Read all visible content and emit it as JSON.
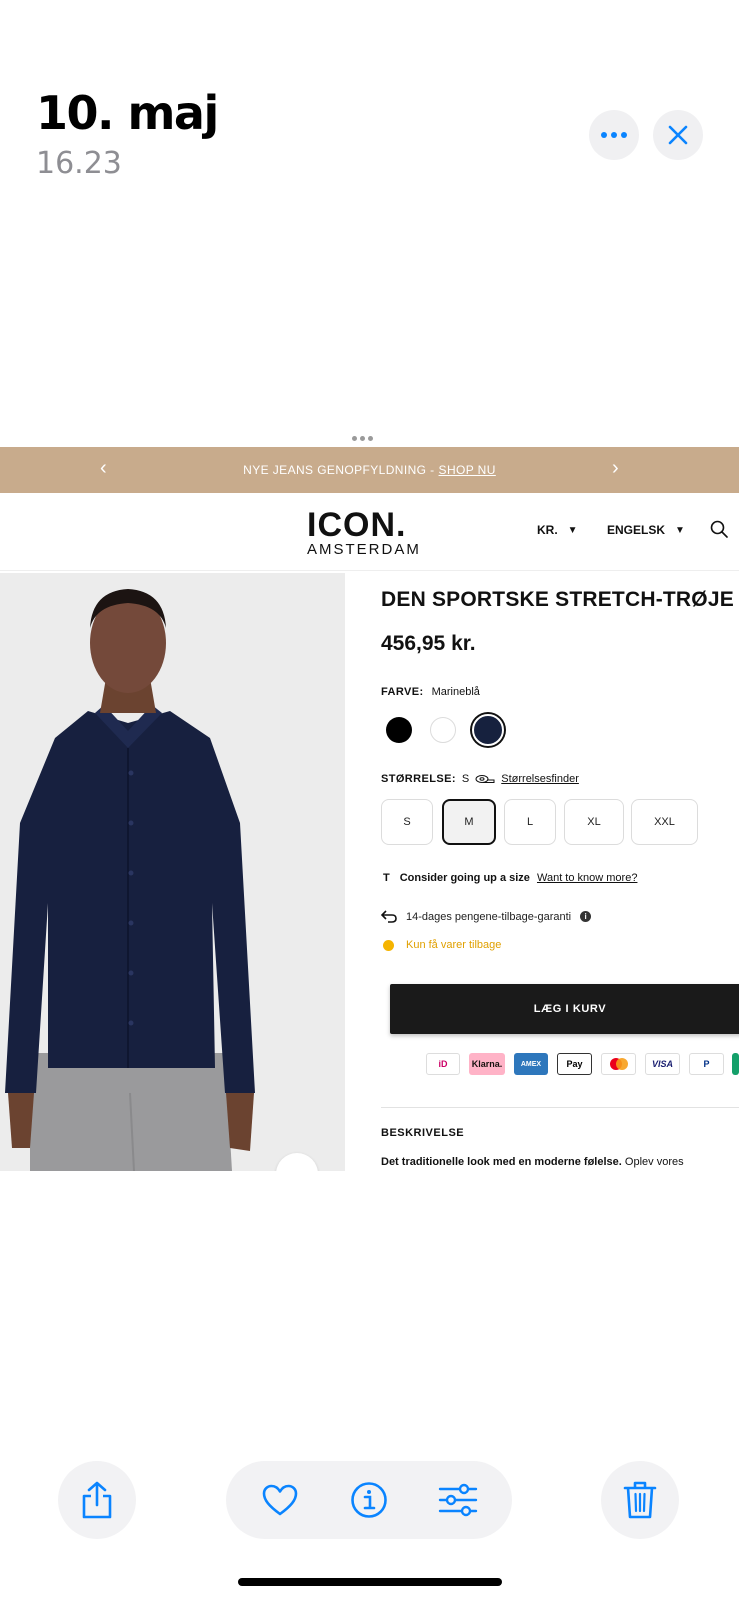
{
  "viewer": {
    "date": "10. maj",
    "time": "16.23"
  },
  "promo": {
    "text": "NYE JEANS GENOPFYLDNING -",
    "link": "SHOP NU"
  },
  "header": {
    "logo_main": "ICON.",
    "logo_sub": "AMSTERDAM",
    "currency": "KR.",
    "language": "ENGELSK"
  },
  "product": {
    "title": "DEN SPORTSKE STRETCH-TRØJE",
    "price": "456,95 kr.",
    "color_label": "FARVE:",
    "color_value": "Marineblå",
    "swatches": [
      "black",
      "white",
      "navy"
    ],
    "selected_swatch": "navy",
    "size_label": "STØRRELSE:",
    "size_value": "S",
    "size_finder": "Størrelsesfinder",
    "sizes": [
      "S",
      "M",
      "L",
      "XL",
      "XXL"
    ],
    "selected_size": "M",
    "fit_hint_icon": "T",
    "fit_hint": "Consider going up a size",
    "fit_hint_link": "Want to know more?",
    "guarantee": "14-dages pengene-tilbage-garanti",
    "stock": "Kun få varer tilbage",
    "add_to_cart": "LÆG I KURV",
    "description_heading": "BESKRIVELSE",
    "description_bold": "Det traditionelle look med en moderne følelse.",
    "description_rest": "Oplev vores"
  },
  "payment_methods": [
    {
      "label": "iD",
      "bg": "#ffffff",
      "fg": "#cc0066",
      "border": "#dddddd"
    },
    {
      "label": "Klarna.",
      "bg": "#ffb3c7",
      "fg": "#17120f",
      "border": "#ffb3c7"
    },
    {
      "label": "AMEX",
      "bg": "#2e77bc",
      "fg": "#ffffff",
      "border": "#2e77bc"
    },
    {
      "label": "Pay",
      "bg": "#ffffff",
      "fg": "#000000",
      "border": "#333333"
    },
    {
      "label": "",
      "bg": "#ffffff",
      "fg": "#000000",
      "border": "#dddddd"
    },
    {
      "label": "VISA",
      "bg": "#ffffff",
      "fg": "#1a1f71",
      "border": "#dddddd"
    },
    {
      "label": "P",
      "bg": "#ffffff",
      "fg": "#003087",
      "border": "#dddddd"
    }
  ],
  "colors": {
    "accent_blue": "#0a84ff",
    "promo_bar": "#c8ab8c",
    "stock_warning": "#f5b400",
    "shirt_navy": "#16213e"
  }
}
